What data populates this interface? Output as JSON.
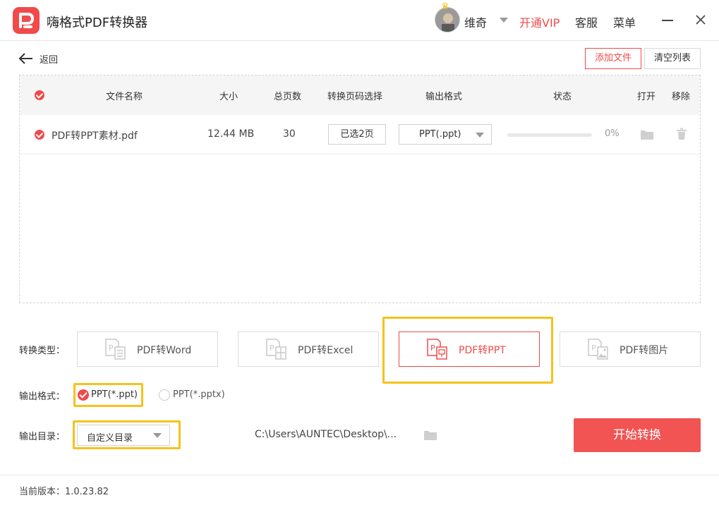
{
  "app": {
    "title": "嗨格式PDF转换器"
  },
  "header": {
    "username": "维奇",
    "vip_label": "开通VIP",
    "service_label": "客服",
    "menu_label": "菜单"
  },
  "toolbar": {
    "back_label": "返回",
    "add_files_label": "添加文件",
    "clear_list_label": "清空列表"
  },
  "table": {
    "columns": {
      "name": "文件名称",
      "size": "大小",
      "pages": "总页数",
      "page_select": "转换页码选择",
      "output_format": "输出格式",
      "status": "状态",
      "open": "打开",
      "remove": "移除"
    },
    "rows": [
      {
        "name": "PDF转PPT素材.pdf",
        "size": "12.44 MB",
        "pages": "30",
        "page_select": "已选2页",
        "output_format": "PPT(.ppt)",
        "progress": "0%",
        "progress_value": 0
      }
    ]
  },
  "convert_type": {
    "label": "转换类型：",
    "options": [
      {
        "label": "PDF转Word",
        "icon": "pdf-to-word-icon"
      },
      {
        "label": "PDF转Excel",
        "icon": "pdf-to-excel-icon"
      },
      {
        "label": "PDF转PPT",
        "icon": "pdf-to-ppt-icon",
        "selected": true
      },
      {
        "label": "PDF转图片",
        "icon": "pdf-to-image-icon"
      }
    ]
  },
  "output_format": {
    "label": "输出格式：",
    "options": [
      {
        "label": "PPT(*.ppt)",
        "selected": true
      },
      {
        "label": "PPT(*.pptx)",
        "selected": false
      }
    ]
  },
  "output_dir": {
    "label": "输出目录：",
    "selected": "自定义目录",
    "path": "C:\\Users\\AUNTEC\\Desktop\\..."
  },
  "actions": {
    "start_label": "开始转换"
  },
  "footer": {
    "version": "当前版本：1.0.23.82"
  },
  "colors": {
    "accent": "#f04a4a",
    "highlight": "#f6c21c"
  }
}
